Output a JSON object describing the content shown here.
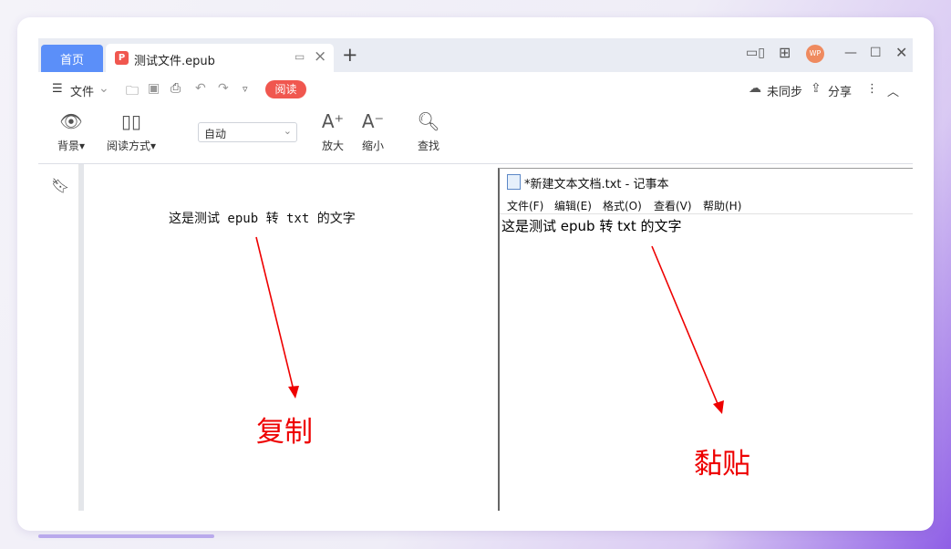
{
  "tabs": {
    "home": "首页",
    "doc": "测试文件.epub"
  },
  "toolbar": {
    "file_menu": "文件",
    "read_pill": "阅读",
    "sync": "未同步",
    "share": "分享"
  },
  "reader_tools": {
    "background": "背景",
    "read_mode": "阅读方式",
    "mode_value": "自动",
    "zoom_in": "放大",
    "zoom_out": "缩小",
    "find": "查找"
  },
  "document": {
    "text": "这是测试 epub 转 txt 的文字"
  },
  "notepad": {
    "title": "*新建文本文档.txt - 记事本",
    "menus": [
      "文件(F)",
      "编辑(E)",
      "格式(O)",
      "查看(V)",
      "帮助(H)"
    ],
    "text": "这是测试 epub 转 txt 的文字"
  },
  "annotations": {
    "copy": "复制",
    "paste": "黏贴",
    "arrow_color": "#ee0000"
  },
  "colors": {
    "accent": "#5b8ff9",
    "read_pill": "#f0574f",
    "avatar": "#ef8a5f"
  },
  "avatar": {
    "text": "WP"
  }
}
